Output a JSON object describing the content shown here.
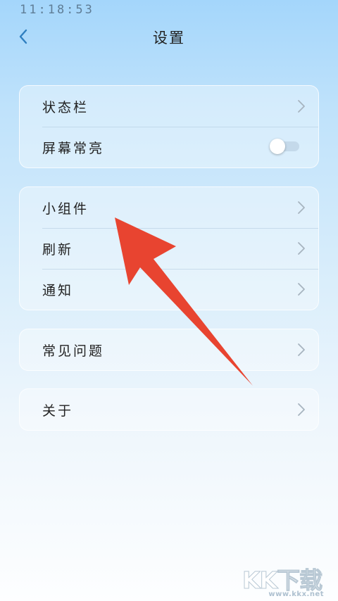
{
  "status_bar": {
    "time": "11:18:53"
  },
  "header": {
    "title": "设置"
  },
  "groups": [
    {
      "items": [
        {
          "label": "状态栏"
        },
        {
          "label": "屏幕常亮",
          "toggle_on": false
        }
      ]
    },
    {
      "items": [
        {
          "label": "小组件"
        },
        {
          "label": "刷新"
        },
        {
          "label": "通知"
        }
      ]
    },
    {
      "items": [
        {
          "label": "常见问题"
        }
      ]
    },
    {
      "items": [
        {
          "label": "关于"
        }
      ]
    }
  ],
  "icons": {
    "back": "chevron-left-icon",
    "row_arrow": "chevron-right-icon"
  },
  "colors": {
    "accent_back": "#2f7fc0",
    "annotation_arrow": "#e84430",
    "toggle_track": "#c4d9ea"
  },
  "watermark": {
    "logo": "KK下载",
    "url": "www.kkx.net"
  }
}
